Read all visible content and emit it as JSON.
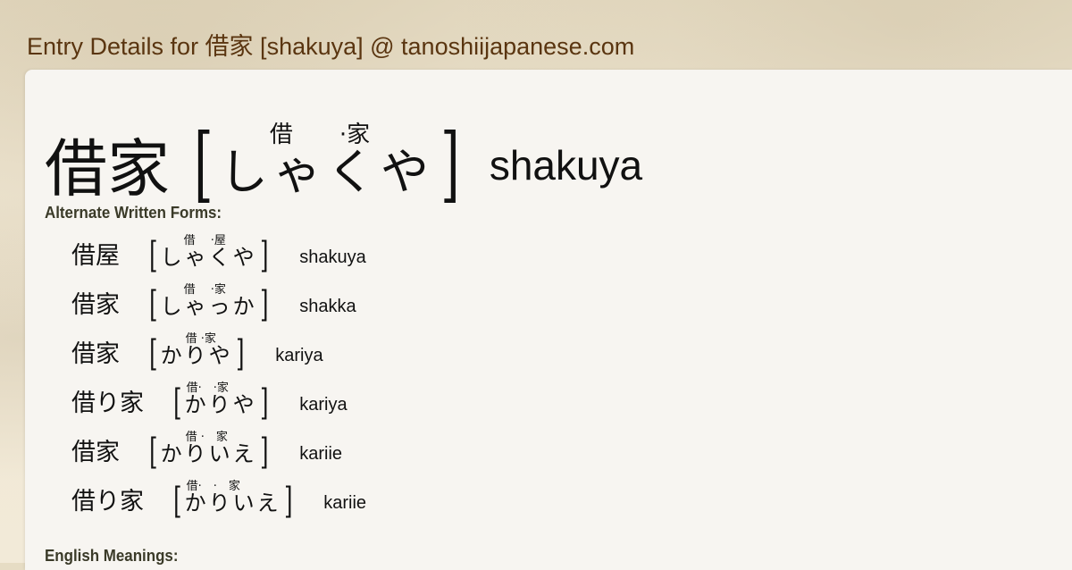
{
  "site_title": "Entry Details for 借家 [shakuya] @ tanoshiijapanese.com",
  "entry": {
    "kanji": "借家",
    "reading": "しゃくや",
    "furigana": "借　　·家",
    "romaji": "shakuya"
  },
  "sections": {
    "alternate_label": "Alternate Written Forms:",
    "meanings_label": "English Meanings:"
  },
  "alternates": [
    {
      "kanji": "借屋",
      "reading": "しゃくや",
      "furigana": "借　 ·屋",
      "romaji": "shakuya"
    },
    {
      "kanji": "借家",
      "reading": "しゃっか",
      "furigana": "借　 ·家",
      "romaji": "shakka"
    },
    {
      "kanji": "借家",
      "reading": "かりや",
      "furigana": "借 ·家",
      "romaji": "kariya"
    },
    {
      "kanji": "借り家",
      "reading": "かりや",
      "furigana": "借·　·家",
      "romaji": "kariya"
    },
    {
      "kanji": "借家",
      "reading": "かりいえ",
      "furigana": "借 ·　家",
      "romaji": "kariie"
    },
    {
      "kanji": "借り家",
      "reading": "かりいえ",
      "furigana": "借·　·　家",
      "romaji": "kariie"
    }
  ],
  "brackets": {
    "open": "[",
    "close": "]"
  }
}
